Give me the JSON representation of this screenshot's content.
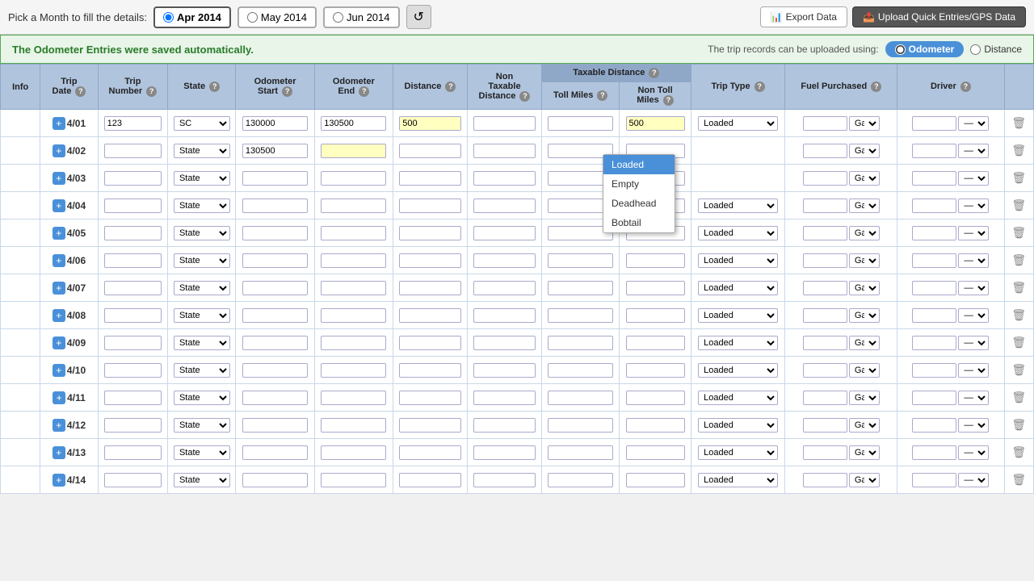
{
  "topBar": {
    "label": "Pick a Month to fill the details:",
    "months": [
      {
        "id": "apr2014",
        "label": "Apr 2014",
        "active": true
      },
      {
        "id": "may2014",
        "label": "May 2014",
        "active": false
      },
      {
        "id": "jun2014",
        "label": "Jun 2014",
        "active": false
      }
    ],
    "refreshIcon": "↺",
    "exportLabel": "Export Data",
    "uploadLabel": "Upload Quick Entries/GPS Data"
  },
  "statusBar": {
    "message": "The Odometer Entries were saved automatically.",
    "uploadNote": "The trip records can be uploaded using:",
    "methods": [
      "Odometer",
      "Distance"
    ],
    "activeMethod": "Odometer"
  },
  "tableHeaders": {
    "info": "Info",
    "tripDate": "Trip Date",
    "tripNumber": "Trip Number",
    "state": "State",
    "odometerStart": "Odometer Start",
    "odometerEnd": "Odometer End",
    "distance": "Distance",
    "nonTaxableDistance": "Non Taxable Distance",
    "taxableDistance": "Taxable Distance",
    "tollMiles": "Toll Miles",
    "nonTollMiles": "Non Toll Miles",
    "tripType": "Trip Type",
    "fuelPurchased": "Fuel Purchased",
    "driver": "Driver"
  },
  "tripTypeOptions": [
    "Loaded",
    "Empty",
    "Deadhead",
    "Bobtail"
  ],
  "rows": [
    {
      "date": "4/01",
      "tripNum": "123",
      "state": "SC",
      "odomStart": "130000",
      "odomEnd": "130500",
      "distance": "500",
      "nonTaxable": "",
      "tollMiles": "",
      "nonTollMiles": "500",
      "tripType": "Loaded",
      "fuel": "",
      "fuelUnit": "Gal",
      "driver": "——",
      "showDropdown": true
    },
    {
      "date": "4/02",
      "tripNum": "",
      "state": "State",
      "odomStart": "130500",
      "odomEnd": "",
      "distance": "",
      "nonTaxable": "",
      "tollMiles": "",
      "nonTollMiles": "",
      "tripType": "",
      "fuel": "",
      "fuelUnit": "Gal",
      "driver": "——",
      "showDropdown": false
    },
    {
      "date": "4/03",
      "tripNum": "",
      "state": "State",
      "odomStart": "",
      "odomEnd": "",
      "distance": "",
      "nonTaxable": "",
      "tollMiles": "",
      "nonTollMiles": "",
      "tripType": "",
      "fuel": "",
      "fuelUnit": "Gal",
      "driver": "——",
      "showDropdown": false
    },
    {
      "date": "4/04",
      "tripNum": "",
      "state": "State",
      "odomStart": "",
      "odomEnd": "",
      "distance": "",
      "nonTaxable": "",
      "tollMiles": "",
      "nonTollMiles": "",
      "tripType": "Loaded",
      "fuel": "",
      "fuelUnit": "Gal",
      "driver": "——",
      "showDropdown": false
    },
    {
      "date": "4/05",
      "tripNum": "",
      "state": "State",
      "odomStart": "",
      "odomEnd": "",
      "distance": "",
      "nonTaxable": "",
      "tollMiles": "",
      "nonTollMiles": "",
      "tripType": "Loaded",
      "fuel": "",
      "fuelUnit": "Gal",
      "driver": "——",
      "showDropdown": false
    },
    {
      "date": "4/06",
      "tripNum": "",
      "state": "State",
      "odomStart": "",
      "odomEnd": "",
      "distance": "",
      "nonTaxable": "",
      "tollMiles": "",
      "nonTollMiles": "",
      "tripType": "Loaded",
      "fuel": "",
      "fuelUnit": "Gal",
      "driver": "——",
      "showDropdown": false
    },
    {
      "date": "4/07",
      "tripNum": "",
      "state": "State",
      "odomStart": "",
      "odomEnd": "",
      "distance": "",
      "nonTaxable": "",
      "tollMiles": "",
      "nonTollMiles": "",
      "tripType": "Loaded",
      "fuel": "",
      "fuelUnit": "Gal",
      "driver": "——",
      "showDropdown": false
    },
    {
      "date": "4/08",
      "tripNum": "",
      "state": "State",
      "odomStart": "",
      "odomEnd": "",
      "distance": "",
      "nonTaxable": "",
      "tollMiles": "",
      "nonTollMiles": "",
      "tripType": "Loaded",
      "fuel": "",
      "fuelUnit": "Gal",
      "driver": "——",
      "showDropdown": false
    },
    {
      "date": "4/09",
      "tripNum": "",
      "state": "State",
      "odomStart": "",
      "odomEnd": "",
      "distance": "",
      "nonTaxable": "",
      "tollMiles": "",
      "nonTollMiles": "",
      "tripType": "Loaded",
      "fuel": "",
      "fuelUnit": "Gal",
      "driver": "——",
      "showDropdown": false
    },
    {
      "date": "4/10",
      "tripNum": "",
      "state": "State",
      "odomStart": "",
      "odomEnd": "",
      "distance": "",
      "nonTaxable": "",
      "tollMiles": "",
      "nonTollMiles": "",
      "tripType": "Loaded",
      "fuel": "",
      "fuelUnit": "Gal",
      "driver": "——",
      "showDropdown": false
    },
    {
      "date": "4/11",
      "tripNum": "",
      "state": "State",
      "odomStart": "",
      "odomEnd": "",
      "distance": "",
      "nonTaxable": "",
      "tollMiles": "",
      "nonTollMiles": "",
      "tripType": "Loaded",
      "fuel": "",
      "fuelUnit": "Gal",
      "driver": "——",
      "showDropdown": false
    },
    {
      "date": "4/12",
      "tripNum": "",
      "state": "State",
      "odomStart": "",
      "odomEnd": "",
      "distance": "",
      "nonTaxable": "",
      "tollMiles": "",
      "nonTollMiles": "",
      "tripType": "Loaded",
      "fuel": "",
      "fuelUnit": "Gal",
      "driver": "——",
      "showDropdown": false
    },
    {
      "date": "4/13",
      "tripNum": "",
      "state": "State",
      "odomStart": "",
      "odomEnd": "",
      "distance": "",
      "nonTaxable": "",
      "tollMiles": "",
      "nonTollMiles": "",
      "tripType": "Loaded",
      "fuel": "",
      "fuelUnit": "Gal",
      "driver": "——",
      "showDropdown": false
    },
    {
      "date": "4/14",
      "tripNum": "",
      "state": "State",
      "odomStart": "",
      "odomEnd": "",
      "distance": "",
      "nonTaxable": "",
      "tollMiles": "",
      "nonTollMiles": "",
      "tripType": "Loaded",
      "fuel": "",
      "fuelUnit": "Gal",
      "driver": "——",
      "showDropdown": false
    }
  ]
}
